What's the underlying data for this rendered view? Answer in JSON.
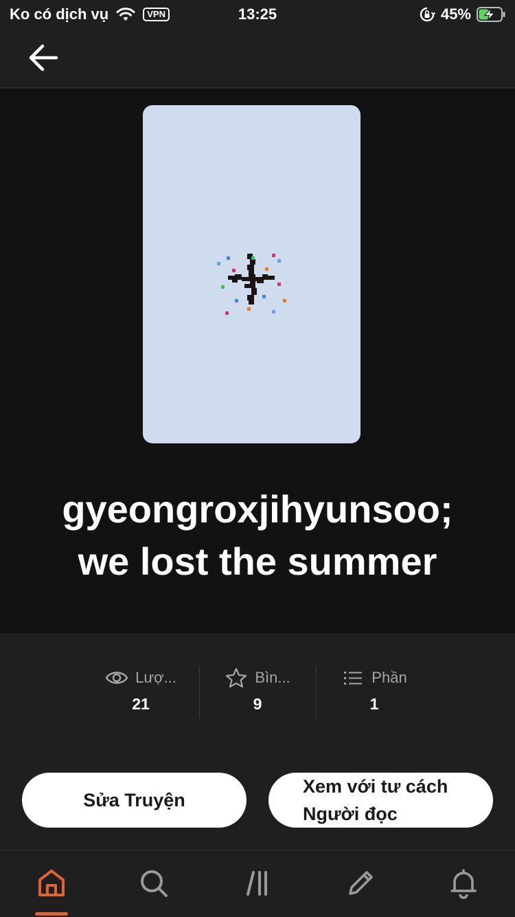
{
  "status_bar": {
    "carrier": "Ko có dịch vụ",
    "vpn": "VPN",
    "time": "13:25",
    "battery_percent": "45%",
    "battery_level": 0.45,
    "icons": [
      "wifi-icon",
      "lock-rotation-icon",
      "battery-charging-icon"
    ]
  },
  "header": {
    "back_icon": "arrow-left-icon"
  },
  "story": {
    "title_line1": "gyeongroxjihyunsoo;",
    "title_line2": "we lost the summer",
    "cover_color": "#cfdcee"
  },
  "stats": [
    {
      "icon": "eye-icon",
      "label": "Lượ...",
      "value": "21"
    },
    {
      "icon": "star-icon",
      "label": "Bìn...",
      "value": "9"
    },
    {
      "icon": "list-icon",
      "label": "Phần",
      "value": "1"
    }
  ],
  "actions": {
    "edit_label": "Sửa Truyện",
    "reader_line1": "Xem với tư cách",
    "reader_line2": "Người đọc"
  },
  "tab_bar": {
    "tabs": [
      "home-icon",
      "search-icon",
      "library-icon",
      "write-icon",
      "bell-icon"
    ],
    "active": "home-icon",
    "accent_color": "#e06336"
  }
}
